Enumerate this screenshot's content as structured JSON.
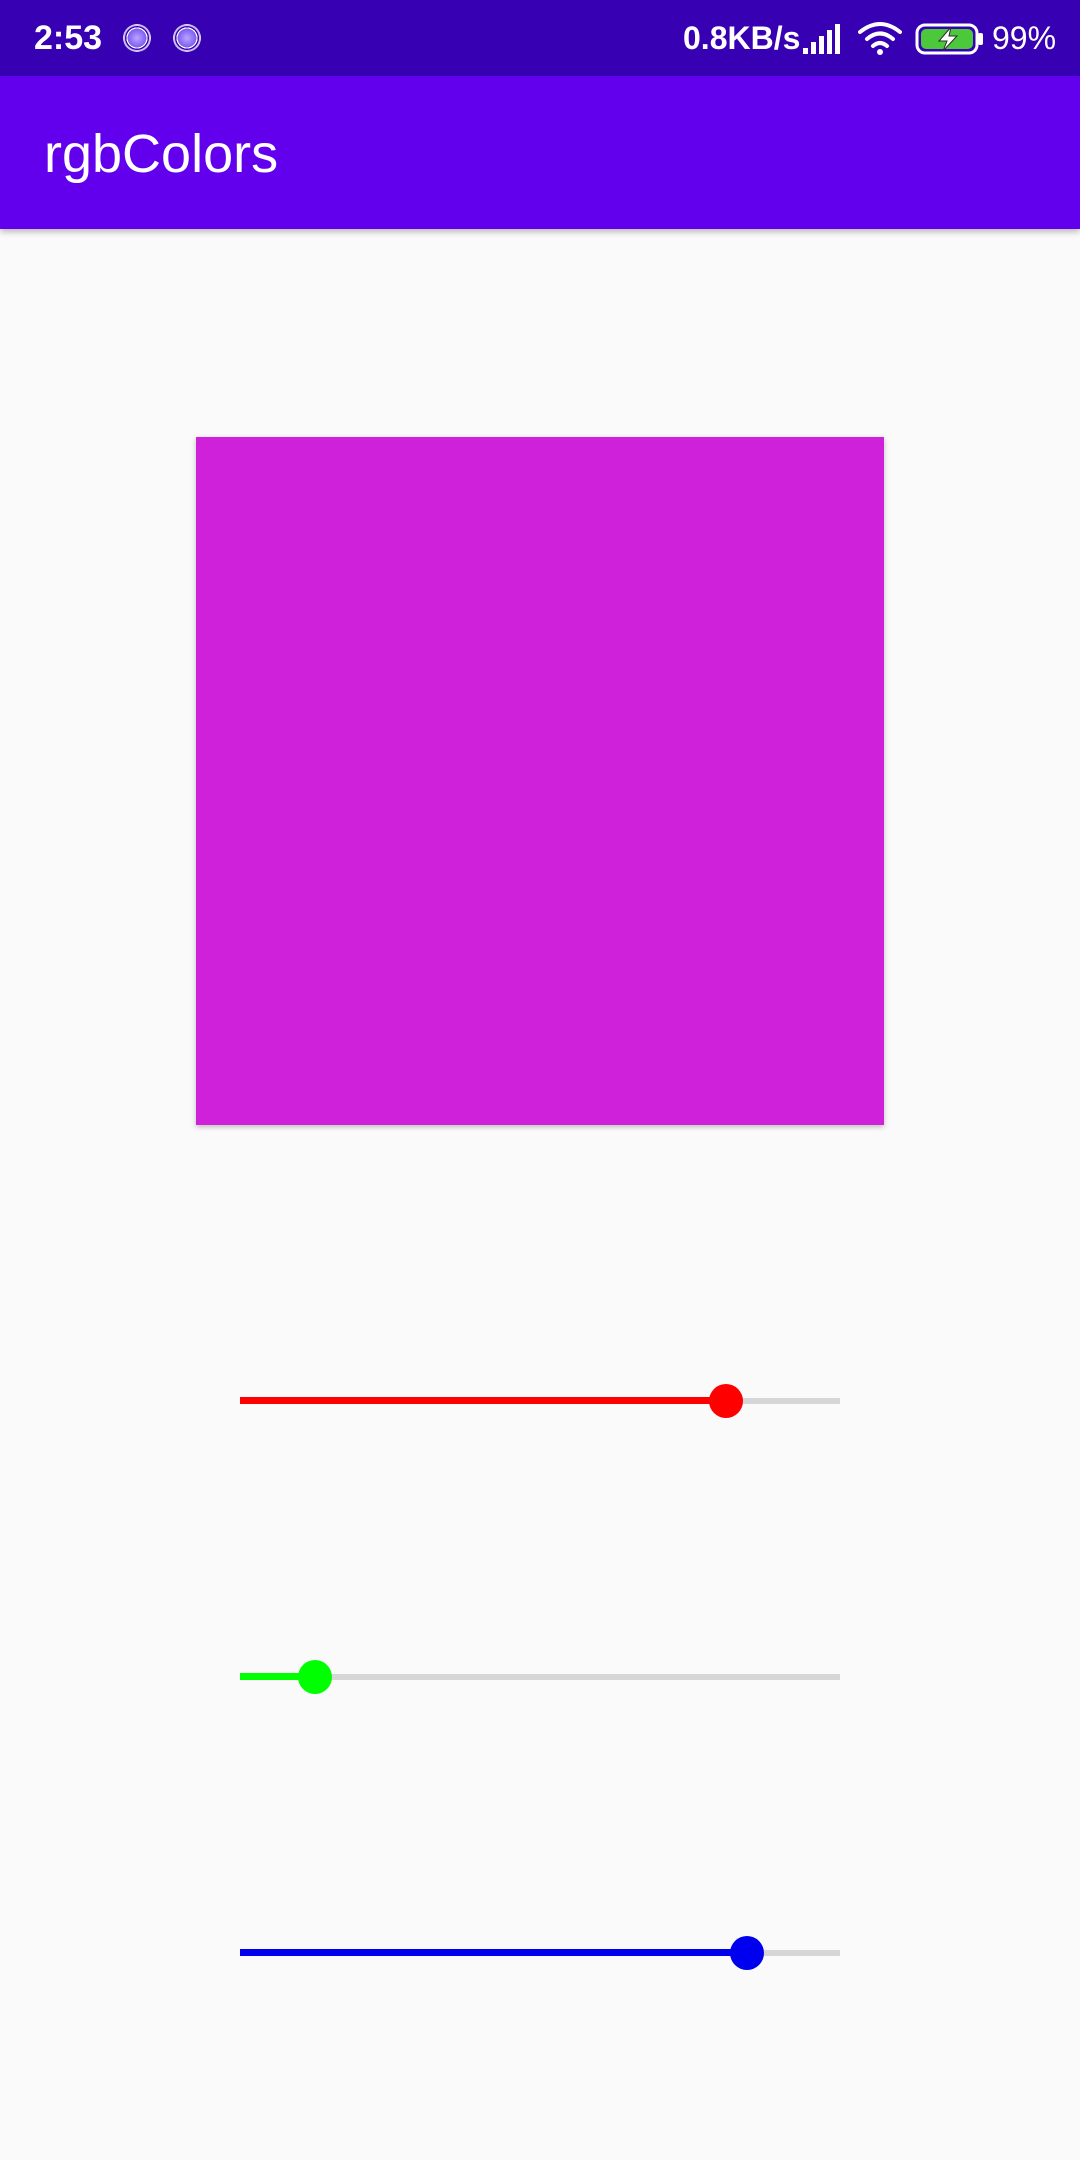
{
  "status_bar": {
    "time": "2:53",
    "network_speed": "0.8KB/s",
    "battery_percent": "99%",
    "icons": [
      "notification-icon",
      "notification-icon",
      "signal-icon",
      "wifi-icon",
      "battery-charging-icon"
    ]
  },
  "app_bar": {
    "title": "rgbColors",
    "color": "#6200EE"
  },
  "preview": {
    "color": "#CF21D9"
  },
  "sliders": {
    "red": {
      "value": 0.81,
      "color": "#FF0000"
    },
    "green": {
      "value": 0.125,
      "color": "#00FF00"
    },
    "blue": {
      "value": 0.845,
      "color": "#0000EE"
    }
  }
}
